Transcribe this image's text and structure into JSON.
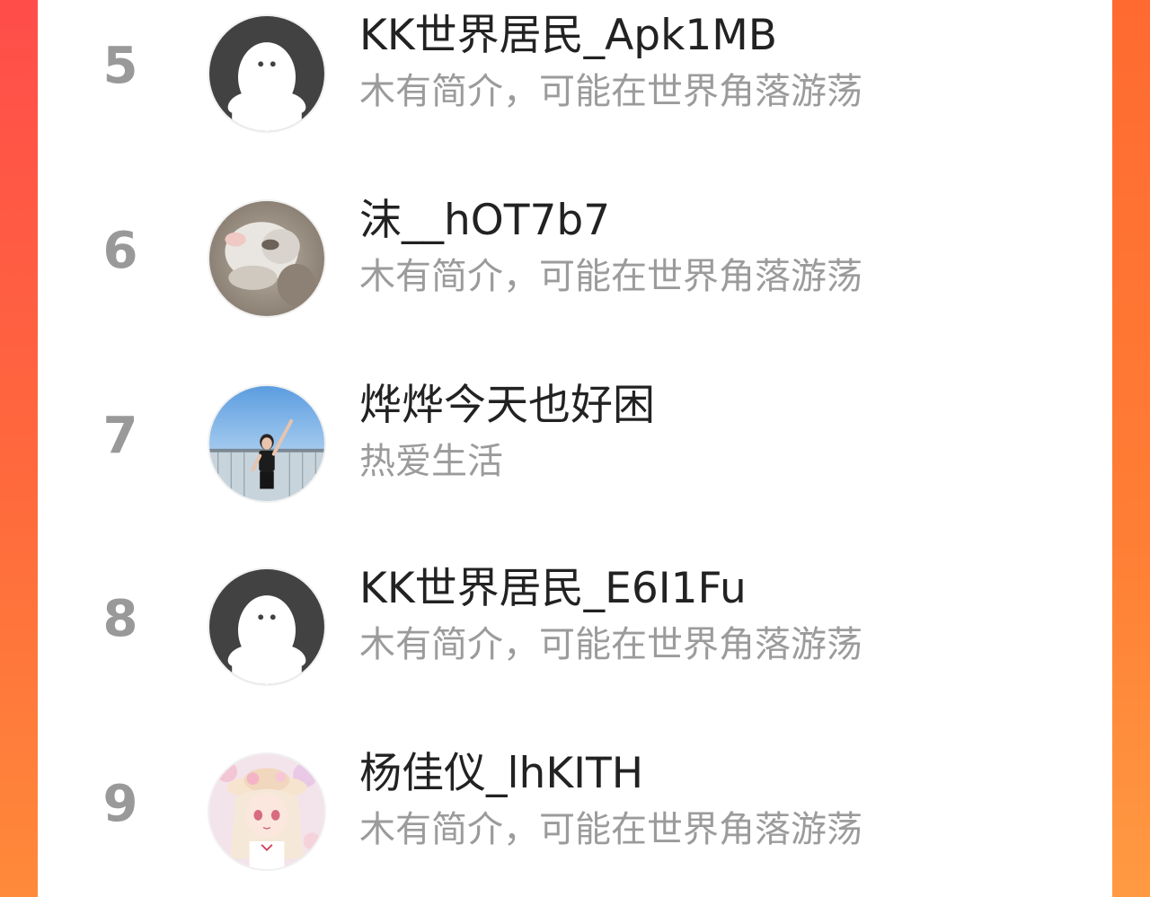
{
  "leaderboard": {
    "rows": [
      {
        "rank": "5",
        "name": "KK世界居民_Apk1MB",
        "bio": "木有简介，可能在世界角落游荡",
        "avatar": "default-avatar-icon"
      },
      {
        "rank": "6",
        "name": "沫__hOT7b7",
        "bio": "木有简介，可能在世界角落游荡",
        "avatar": "cat-photo-avatar"
      },
      {
        "rank": "7",
        "name": "烨烨今天也好困",
        "bio": "热爱生活",
        "avatar": "girl-photo-avatar"
      },
      {
        "rank": "8",
        "name": "KK世界居民_E6I1Fu",
        "bio": "木有简介，可能在世界角落游荡",
        "avatar": "default-avatar-icon"
      },
      {
        "rank": "9",
        "name": "杨佳仪_lhKITH",
        "bio": "木有简介，可能在世界角落游荡",
        "avatar": "anime-girl-avatar"
      }
    ]
  },
  "colors": {
    "background_gradient_top": "#ff4d4a",
    "background_gradient_bottom": "#ff8a3a",
    "rank_text": "#999999",
    "name_text": "#222222",
    "bio_text": "#9b9b9b"
  }
}
